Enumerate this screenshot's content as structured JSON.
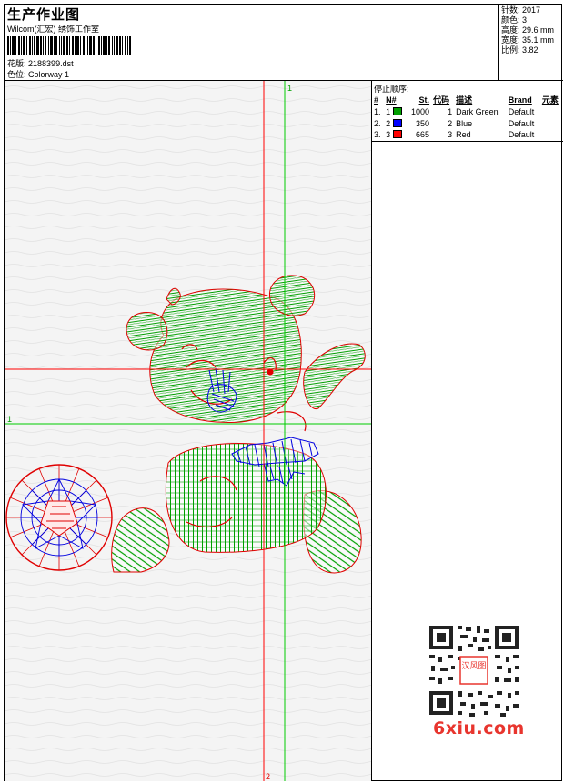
{
  "header": {
    "title": "生产作业图",
    "company": "Wilcom(汇宏) 绣饰工作室",
    "design_label": "花版:",
    "design_value": "2188399.dst",
    "colorway_label": "色位:",
    "colorway_value": "Colorway 1"
  },
  "stats": {
    "stitches": "针数: 2017",
    "colors": "颜色: 3",
    "height": "高度: 29.6 mm",
    "width": "宽度: 35.1 mm",
    "ratio": "比例: 3.82"
  },
  "crosshair": {
    "top_marker": "1",
    "left_marker": "1",
    "bottom_marker": "2"
  },
  "sequence": {
    "heading": "停止顺序:",
    "columns": [
      "#",
      "N#",
      "St.",
      "代码",
      "描述",
      "Brand",
      "元素"
    ],
    "rows": [
      {
        "idx": "1.",
        "n": "1",
        "color": "#00a000",
        "st": "1000",
        "code": "1",
        "desc": "Dark Green",
        "brand": "Default",
        "elem": ""
      },
      {
        "idx": "2.",
        "n": "2",
        "color": "#0000ff",
        "st": "350",
        "code": "2",
        "desc": "Blue",
        "brand": "Default",
        "elem": ""
      },
      {
        "idx": "3.",
        "n": "3",
        "color": "#ff0000",
        "st": "665",
        "code": "3",
        "desc": "Red",
        "brand": "Default",
        "elem": ""
      }
    ]
  },
  "watermark": {
    "text": "6xiu.com",
    "seal_text": "汉风图"
  },
  "colors": {
    "dark_green": "#00a000",
    "blue": "#0000ff",
    "red": "#ff0000"
  }
}
